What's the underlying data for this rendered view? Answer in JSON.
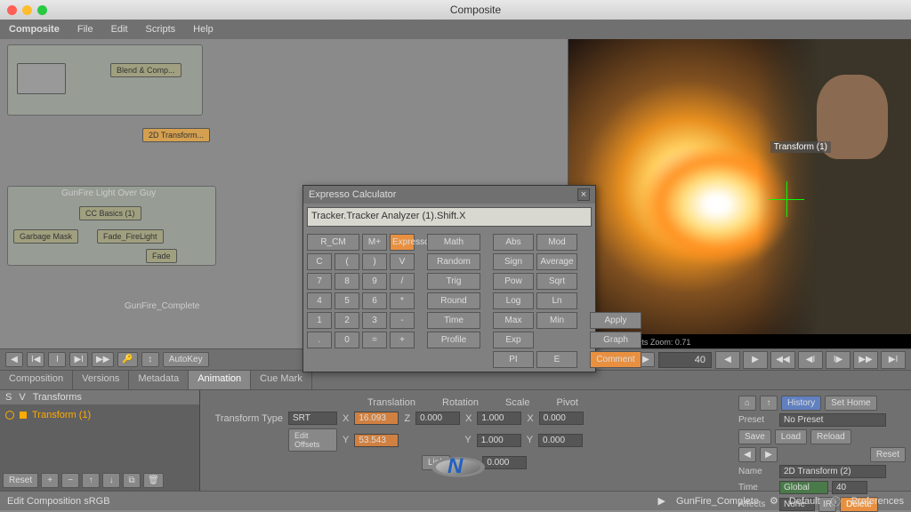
{
  "titlebar": {
    "title": "Composite"
  },
  "menubar": {
    "app": "Composite",
    "items": [
      "File",
      "Edit",
      "Scripts",
      "Help"
    ]
  },
  "nodes": {
    "group1_label": "",
    "blend_comp": "Blend & Comp...",
    "transform_2d": "2D Transform...",
    "group2_label": "GunFire Light Over Guy",
    "cc_basics": "CC Basics (1)",
    "garbage_mask": "Garbage Mask",
    "fade_firelight": "Fade_FireLight",
    "fade": "Fade",
    "graph_label": "GunFire_Complete"
  },
  "viewer": {
    "overlay": "Transform (1)",
    "info": "248×1024 1:1  16 Bits  Zoom: 0.71"
  },
  "calc": {
    "title": "Expresso Calculator",
    "input": "Tracker.Tracker Analyzer (1).Shift.X",
    "row1": [
      "R_CM",
      "M+",
      "Expresso",
      "Math",
      "Abs",
      "Mod"
    ],
    "row2": [
      "C",
      "(",
      ")",
      "V",
      "Random",
      "Sign",
      "Average"
    ],
    "row3": [
      "7",
      "8",
      "9",
      "/",
      "Trig",
      "Pow",
      "Sqrt"
    ],
    "row4": [
      "4",
      "5",
      "6",
      "*",
      "Round",
      "Log",
      "Ln"
    ],
    "row5": [
      "1",
      "2",
      "3",
      "-",
      "Time",
      "Max",
      "Min",
      "Apply"
    ],
    "row6": [
      ".",
      "0",
      "=",
      "+",
      "Profile",
      "Exp",
      "",
      "Graph"
    ],
    "row7": [
      "",
      "",
      "",
      "",
      "",
      "PI",
      "E",
      "Comment"
    ]
  },
  "toolbar": {
    "autokey": "AutoKey",
    "frame": "40"
  },
  "tabs": [
    "Composition",
    "Versions",
    "Metadata",
    "Animation",
    "Cue Mark"
  ],
  "transforms": {
    "header_s": "S",
    "header_v": "V",
    "header_name": "Transforms",
    "item1": "Transform (1)",
    "reset": "Reset"
  },
  "params": {
    "headers": [
      "Translation",
      "Rotation",
      "Scale",
      "Pivot"
    ],
    "type_label": "Transform Type",
    "type_value": "SRT",
    "edit_offsets": "Edit Offsets",
    "x": "X",
    "y": "Y",
    "z": "Z",
    "r": "R",
    "tx": "16.093",
    "ty": "53.543",
    "tz": "0.000",
    "sx": "1.000",
    "sy": "1.000",
    "px": "0.000",
    "py": "0.000",
    "pr": "0.000",
    "link": "Link"
  },
  "right": {
    "history": "History",
    "set_home": "Set Home",
    "preset": "Preset",
    "no_preset": "No Preset",
    "save": "Save",
    "load": "Load",
    "reload": "Reload",
    "reset": "Reset",
    "name": "Name",
    "name_val": "2D Transform (2)",
    "time": "Time",
    "time_val": "Global",
    "time_frame": "40",
    "affects": "Affects",
    "affects_val": "None",
    "ir": "IR",
    "delete": "Delete"
  },
  "status": {
    "edit": "Edit Composition sRGB",
    "comp": "GunFire_Complete",
    "default": "Default",
    "prefs": "Preferences"
  }
}
